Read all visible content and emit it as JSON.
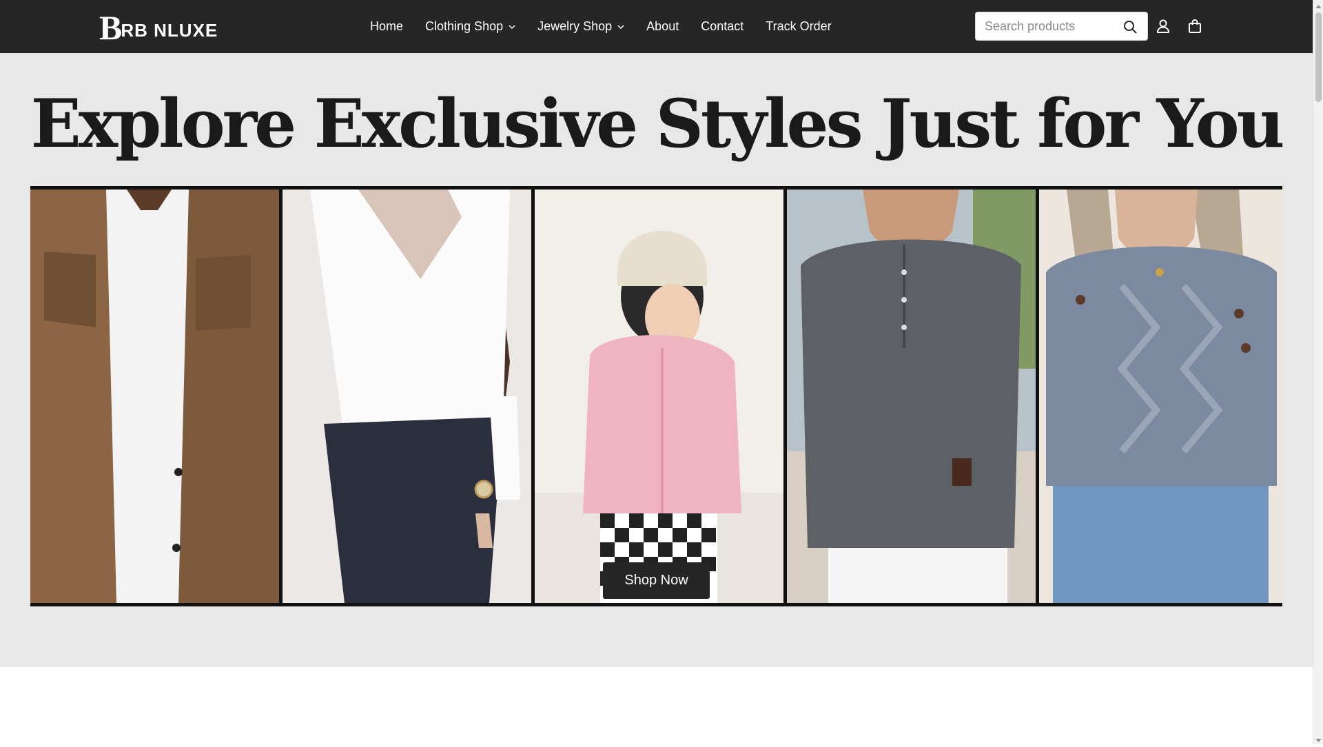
{
  "header": {
    "logo_initial": "B",
    "logo_rest": "RB NLUXE",
    "nav": [
      {
        "label": "Home",
        "has_dropdown": false
      },
      {
        "label": "Clothing Shop",
        "has_dropdown": true
      },
      {
        "label": "Jewelry Shop",
        "has_dropdown": true
      },
      {
        "label": "About",
        "has_dropdown": false
      },
      {
        "label": "Contact",
        "has_dropdown": false
      },
      {
        "label": "Track Order",
        "has_dropdown": false
      }
    ],
    "search": {
      "placeholder": "Search products",
      "value": ""
    },
    "icons": [
      "search-icon",
      "account-icon",
      "cart-icon"
    ]
  },
  "hero": {
    "title": "Explore Exclusive Styles Just for You",
    "cta_label": "Shop Now",
    "banner_panels": [
      "man-in-herringbone-jacket",
      "woman-in-white-wrap-blouse",
      "child-in-pink-fleece-and-beanie",
      "man-in-grey-henley",
      "woman-in-grey-cable-knit-sweater"
    ]
  },
  "colors": {
    "header_bg": "#262626",
    "hero_bg": "#e8e8e8",
    "button_bg": "#262626",
    "text_light": "#ffffff"
  }
}
